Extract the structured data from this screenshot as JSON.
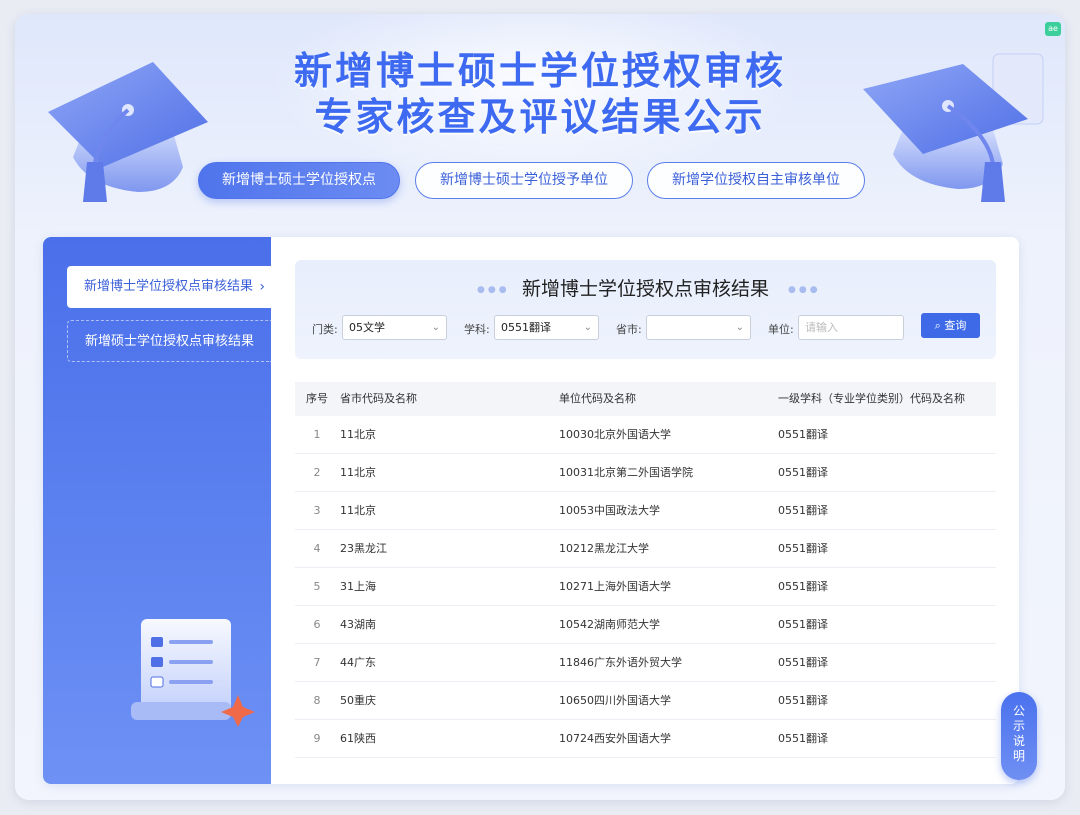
{
  "header": {
    "title_line1": "新增博士硕士学位授权审核",
    "title_line2": "专家核查及评议结果公示"
  },
  "top_tabs": [
    {
      "label": "新增博士硕士学位授权点",
      "active": true
    },
    {
      "label": "新增博士硕士学位授予单位",
      "active": false
    },
    {
      "label": "新增学位授权自主审核单位",
      "active": false
    }
  ],
  "sidebar": {
    "items": [
      {
        "label": "新增博士学位授权点审核结果",
        "active": true
      },
      {
        "label": "新增硕士学位授权点审核结果",
        "active": false
      }
    ],
    "chevron": "chevron-right-icon"
  },
  "panel": {
    "title": "新增博士学位授权点审核结果",
    "filters": {
      "category_label": "门类:",
      "category_value": "05文学",
      "subject_label": "学科:",
      "subject_value": "0551翻译",
      "province_label": "省市:",
      "province_value": "",
      "unit_label": "单位:",
      "unit_placeholder": "请输入",
      "query_label": "查询"
    }
  },
  "table": {
    "headers": [
      "序号",
      "省市代码及名称",
      "单位代码及名称",
      "一级学科（专业学位类别）代码及名称"
    ],
    "rows": [
      {
        "no": "1",
        "province": "11北京",
        "unit": "10030北京外国语大学",
        "subject": "0551翻译"
      },
      {
        "no": "2",
        "province": "11北京",
        "unit": "10031北京第二外国语学院",
        "subject": "0551翻译"
      },
      {
        "no": "3",
        "province": "11北京",
        "unit": "10053中国政法大学",
        "subject": "0551翻译"
      },
      {
        "no": "4",
        "province": "23黑龙江",
        "unit": "10212黑龙江大学",
        "subject": "0551翻译"
      },
      {
        "no": "5",
        "province": "31上海",
        "unit": "10271上海外国语大学",
        "subject": "0551翻译"
      },
      {
        "no": "6",
        "province": "43湖南",
        "unit": "10542湖南师范大学",
        "subject": "0551翻译"
      },
      {
        "no": "7",
        "province": "44广东",
        "unit": "11846广东外语外贸大学",
        "subject": "0551翻译"
      },
      {
        "no": "8",
        "province": "50重庆",
        "unit": "10650四川外国语大学",
        "subject": "0551翻译"
      },
      {
        "no": "9",
        "province": "61陕西",
        "unit": "10724西安外国语大学",
        "subject": "0551翻译"
      }
    ]
  },
  "floating": {
    "notice_chars": [
      "公",
      "示",
      "说",
      "明"
    ]
  },
  "colors": {
    "accent": "#3e6ae8",
    "title_blue": "#3d6af0",
    "sidebar_blue": "#4a6fea"
  }
}
